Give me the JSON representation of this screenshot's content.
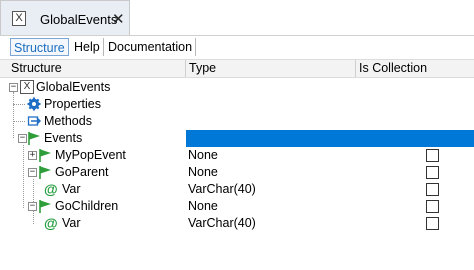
{
  "window": {
    "tab_icon_letter": "X",
    "tab_title": "GlobalEvents",
    "close_glyph": "✕"
  },
  "subtabs": [
    {
      "label": "Structure",
      "active": true
    },
    {
      "label": "Help",
      "active": false
    },
    {
      "label": "Documentation",
      "active": false
    }
  ],
  "columns": {
    "structure": "Structure",
    "type": "Type",
    "is_collection": "Is Collection"
  },
  "tree": {
    "root": {
      "label": "GlobalEvents",
      "icon": "x-object-icon",
      "expander": "−"
    },
    "properties": {
      "label": "Properties",
      "icon": "gear-icon"
    },
    "methods": {
      "label": "Methods",
      "icon": "method-arrow-icon"
    },
    "events": {
      "label": "Events",
      "icon": "flag-icon",
      "expander": "−",
      "selected": true
    },
    "my_pop_event": {
      "label": "MyPopEvent",
      "type": "None",
      "expander": "+",
      "is_collection": false
    },
    "go_parent": {
      "label": "GoParent",
      "type": "None",
      "expander": "−",
      "is_collection": false
    },
    "go_parent_var": {
      "label": "Var",
      "type": "VarChar(40)",
      "is_collection": false
    },
    "go_children": {
      "label": "GoChildren",
      "type": "None",
      "expander": "−",
      "is_collection": false
    },
    "go_children_var": {
      "label": "Var",
      "type": "VarChar(40)",
      "is_collection": false
    }
  },
  "colors": {
    "selection": "#0078d7",
    "flag_green": "#2e9e3b",
    "parameter_green": "#1f9a3a",
    "accent_blue": "#1a6ec2"
  }
}
